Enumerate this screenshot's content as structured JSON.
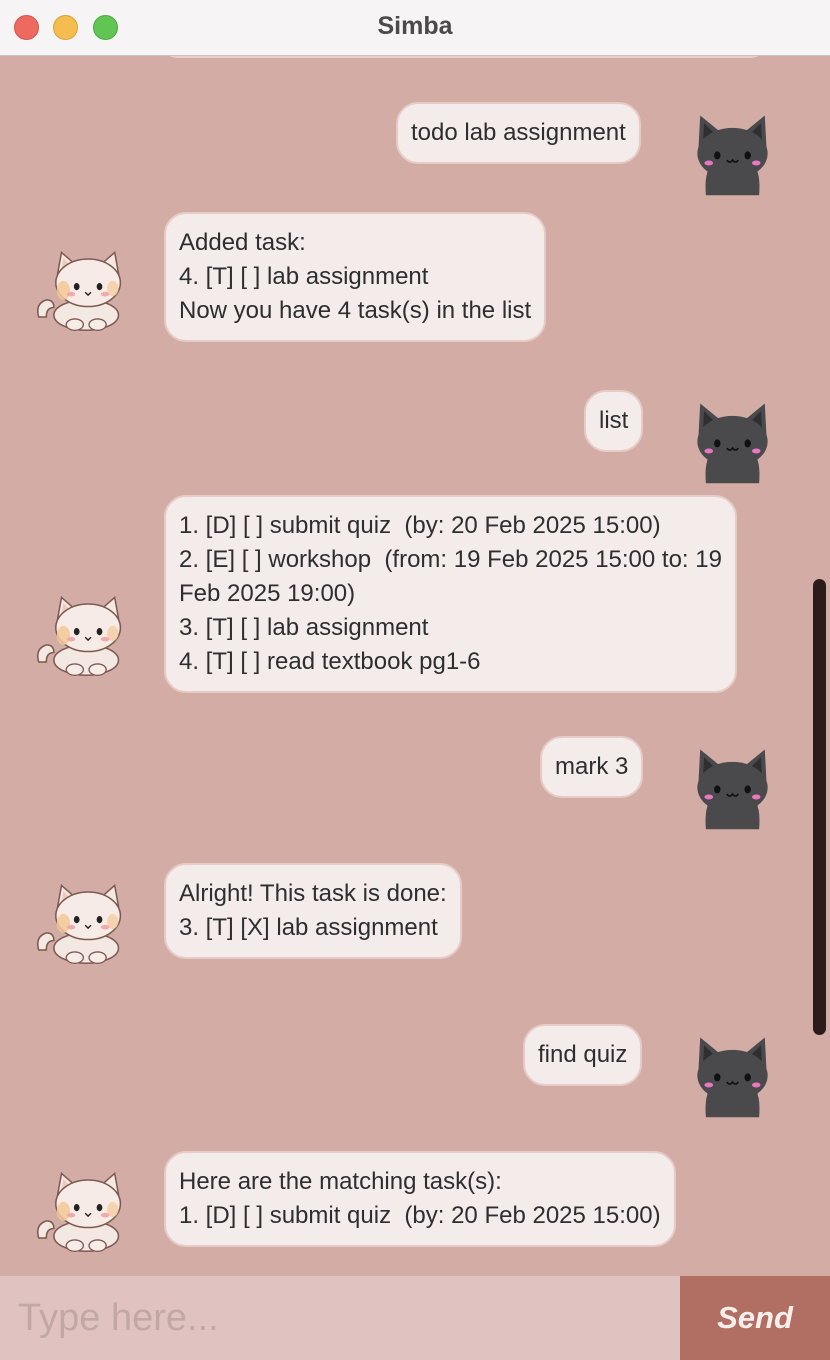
{
  "window": {
    "title": "Simba"
  },
  "messages": [
    {
      "from": "user",
      "lines": [
        "todo lab assignment"
      ]
    },
    {
      "from": "bot",
      "lines": [
        "Added task:",
        "4. [T] [ ] lab assignment",
        "Now you have 4 task(s) in the list"
      ]
    },
    {
      "from": "user",
      "lines": [
        "list"
      ]
    },
    {
      "from": "bot",
      "lines": [
        "1. [D] [ ] submit quiz  (by: 20 Feb 2025 15:00)",
        "2. [E] [ ] workshop  (from: 19 Feb 2025 15:00 to: 19",
        "Feb 2025 19:00)",
        "3. [T] [ ] lab assignment",
        "4. [T] [ ] read textbook pg1-6"
      ]
    },
    {
      "from": "user",
      "lines": [
        "mark 3"
      ]
    },
    {
      "from": "bot",
      "lines": [
        "Alright! This task is done:",
        "3. [T] [X] lab assignment"
      ]
    },
    {
      "from": "user",
      "lines": [
        "find quiz"
      ]
    },
    {
      "from": "bot",
      "lines": [
        "Here are the matching task(s):",
        "1. [D] [ ] submit quiz  (by: 20 Feb 2025 15:00)"
      ]
    }
  ],
  "input": {
    "placeholder": "Type here...",
    "value": ""
  },
  "send_button": {
    "label": "Send"
  },
  "colors": {
    "background": "#d3ada5",
    "bubble": "#f3ecea",
    "send_button": "#b16e62",
    "input": "#e0c3c0",
    "scrollbar": "#2c1b1b"
  }
}
